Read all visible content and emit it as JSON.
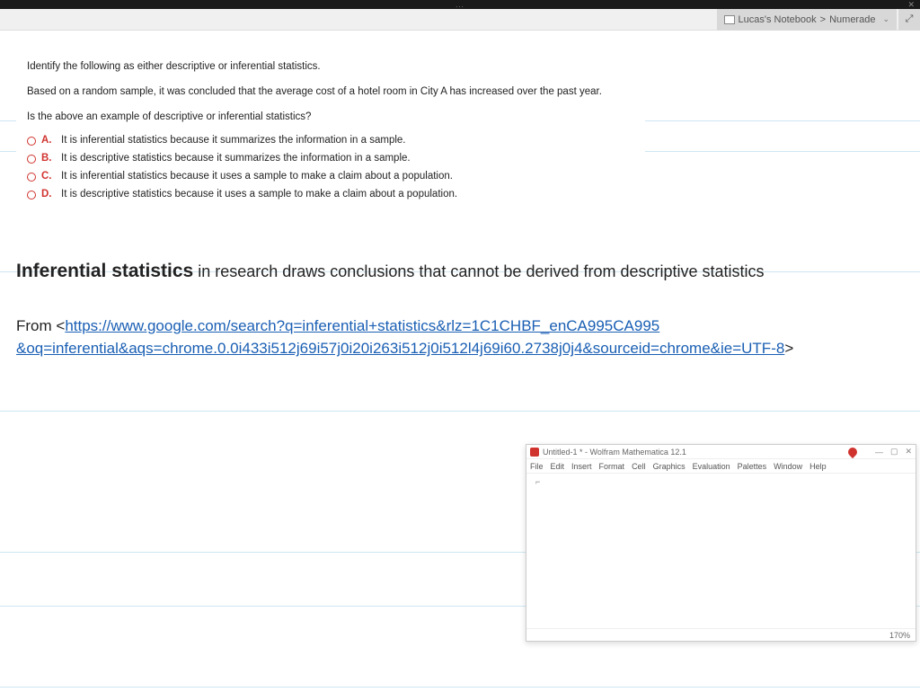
{
  "titlebar": {
    "dots": "..."
  },
  "toolbar": {
    "breadcrumb_notebook": "Lucas's Notebook",
    "breadcrumb_sep": ">",
    "breadcrumb_page": "Numerade",
    "expand_glyph": "⤢"
  },
  "question": {
    "prompt1": "Identify the following as either descriptive or inferential statistics.",
    "prompt2": "Based on a random sample, it was concluded that the average cost of a hotel room in City A has increased over the past year.",
    "prompt3": "Is the above an example of descriptive or inferential statistics?",
    "options": [
      {
        "letter": "A.",
        "text": "It is inferential statistics because it summarizes the information in a sample."
      },
      {
        "letter": "B.",
        "text": "It is descriptive statistics because it summarizes the information in a sample."
      },
      {
        "letter": "C.",
        "text": "It is inferential statistics because it uses a sample to make a claim about a population."
      },
      {
        "letter": "D.",
        "text": "It is descriptive statistics because it uses a sample to make a claim about a population."
      }
    ]
  },
  "note": {
    "bold": "Inferential statistics",
    "rest": " in research draws conclusions that cannot be derived from descriptive statistics"
  },
  "source": {
    "prefix": "From <",
    "url_line1": "https://www.google.com/search?q=inferential+statistics&rlz=1C1CHBF_enCA995CA995",
    "url_line2": "&oq=inferential&aqs=chrome.0.0i433i512j69i57j0i20i263i512j0i512l4j69i60.2738j0j4&sourceid=chrome&ie=UTF-8",
    "suffix": ">"
  },
  "mathematica": {
    "title": "Untitled-1 * - Wolfram Mathematica 12.1",
    "menus": [
      "File",
      "Edit",
      "Insert",
      "Format",
      "Cell",
      "Graphics",
      "Evaluation",
      "Palettes",
      "Window",
      "Help"
    ],
    "zoom": "170%",
    "minimize": "—",
    "maximize": "▢",
    "close": "✕"
  },
  "ruled_line_positions": [
    100,
    134,
    268,
    423,
    580,
    640,
    730
  ]
}
